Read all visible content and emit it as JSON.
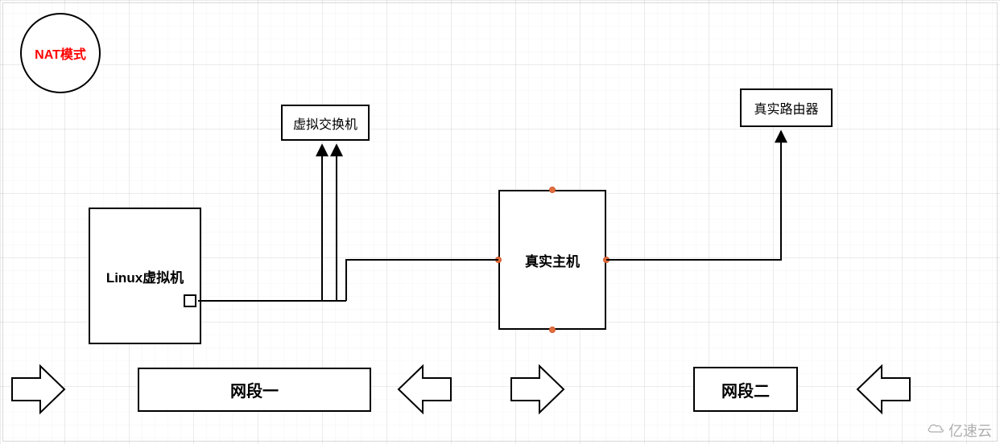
{
  "title": "NAT模式",
  "nodes": {
    "vm": "Linux虚拟机",
    "vswitch": "虚拟交换机",
    "host": "真实主机",
    "router": "真实路由器"
  },
  "segments": {
    "one": "网段一",
    "two": "网段二"
  },
  "watermark": "亿速云"
}
